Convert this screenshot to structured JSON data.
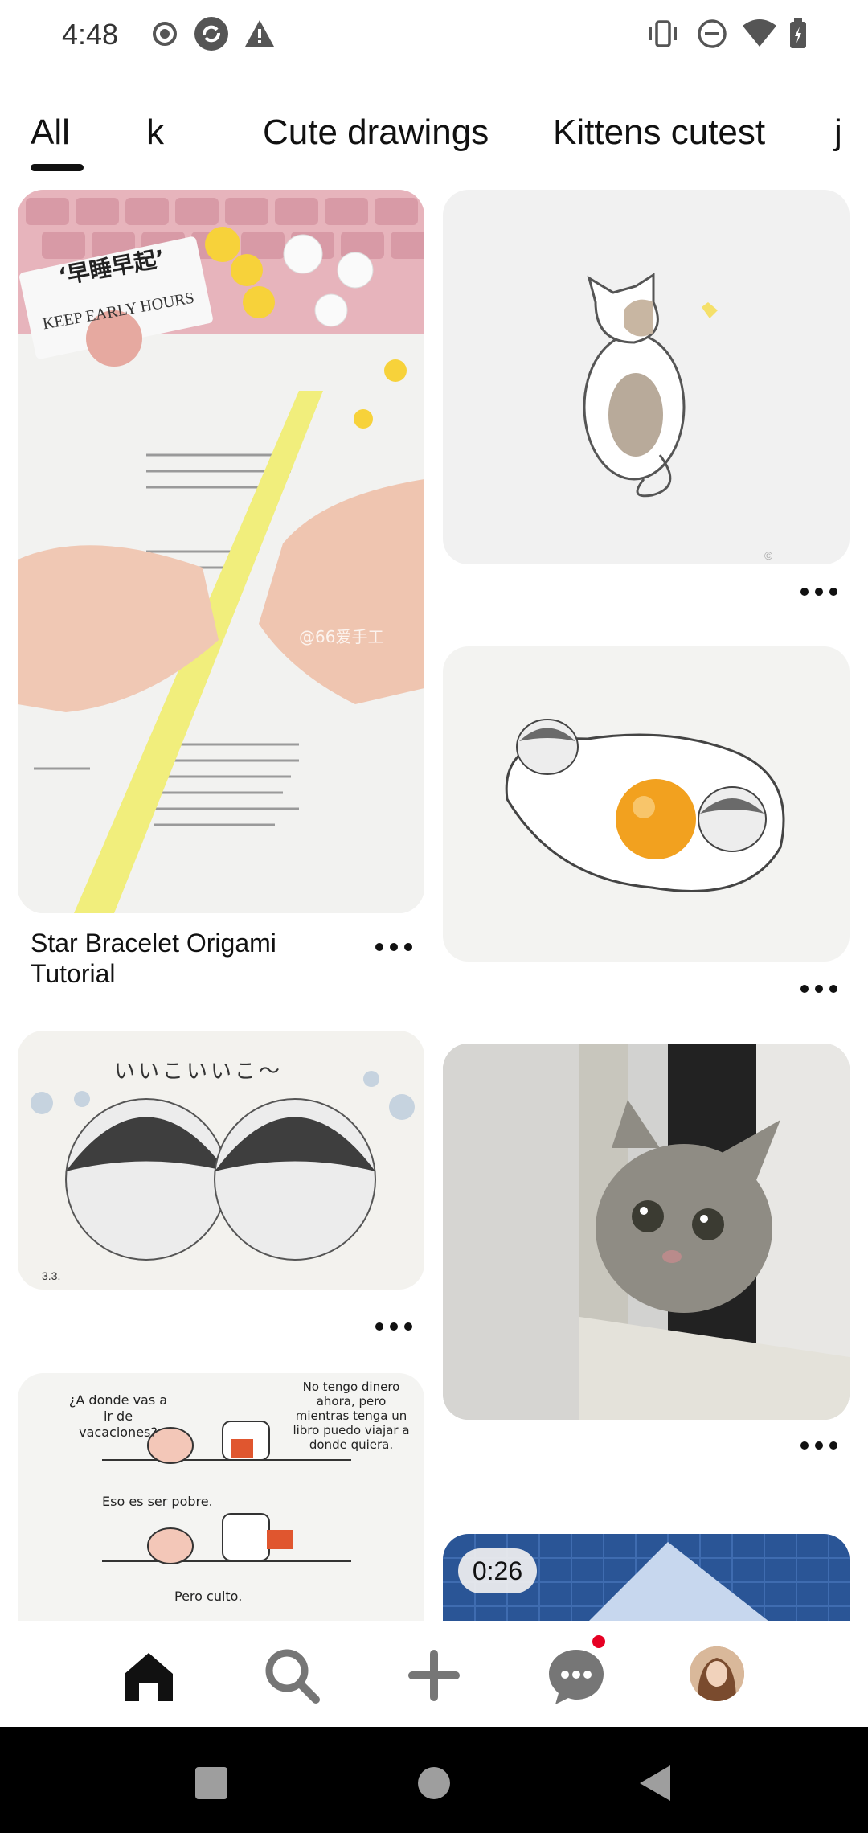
{
  "status_bar": {
    "time": "4:48",
    "left_icons": [
      "record-icon",
      "sync-icon",
      "warning-icon"
    ],
    "right_icons": [
      "vibrate-icon",
      "do-not-disturb-icon",
      "wifi-icon",
      "battery-icon"
    ]
  },
  "tabs": {
    "items": [
      {
        "label": "All",
        "selected": true
      },
      {
        "label": "k",
        "selected": false
      },
      {
        "label": "Cute drawings",
        "selected": false
      },
      {
        "label": "Kittens cutest",
        "selected": false
      },
      {
        "label": "j",
        "selected": false
      }
    ]
  },
  "feed": {
    "pins": [
      {
        "title": "Star Bracelet Origami Tutorial",
        "image_desc": "origami-hands-photo",
        "overlay_texts": [
          "‘早睡早起’",
          "KEEP EARLY HOURS",
          "@66爱手工"
        ]
      },
      {
        "title": "",
        "image_desc": "cat-drawing"
      },
      {
        "title": "",
        "image_desc": "penguins-egg-drawing"
      },
      {
        "title": "",
        "image_desc": "penguins-drawing",
        "overlay_texts": [
          "いいこいいこ〜"
        ]
      },
      {
        "title": "",
        "image_desc": "kitten-photo"
      },
      {
        "title": "",
        "image_desc": "comic-pig-penguin",
        "overlay_texts": [
          "¿A donde vas a ir de vacaciones?",
          "No tengo dinero ahora, pero mientras tenga un libro puedo viajar a donde quiera.",
          "Eso es ser pobre.",
          "Pero culto."
        ]
      },
      {
        "title": "",
        "image_desc": "video-pin",
        "video_duration": "0:26"
      }
    ],
    "more_icon": "more-dots-icon"
  },
  "bottom_nav": {
    "items": [
      {
        "name": "home",
        "icon": "home-icon",
        "active": true
      },
      {
        "name": "search",
        "icon": "search-icon",
        "active": false
      },
      {
        "name": "create",
        "icon": "plus-icon",
        "active": false
      },
      {
        "name": "messages",
        "icon": "chat-icon",
        "active": false,
        "has_notification": true
      },
      {
        "name": "profile",
        "icon": "avatar",
        "active": false
      }
    ]
  },
  "system_nav": {
    "items": [
      "recents-icon",
      "home-circle-icon",
      "back-icon"
    ]
  },
  "colors": {
    "notification": "#e60023",
    "text": "#111111",
    "background": "#ffffff"
  }
}
